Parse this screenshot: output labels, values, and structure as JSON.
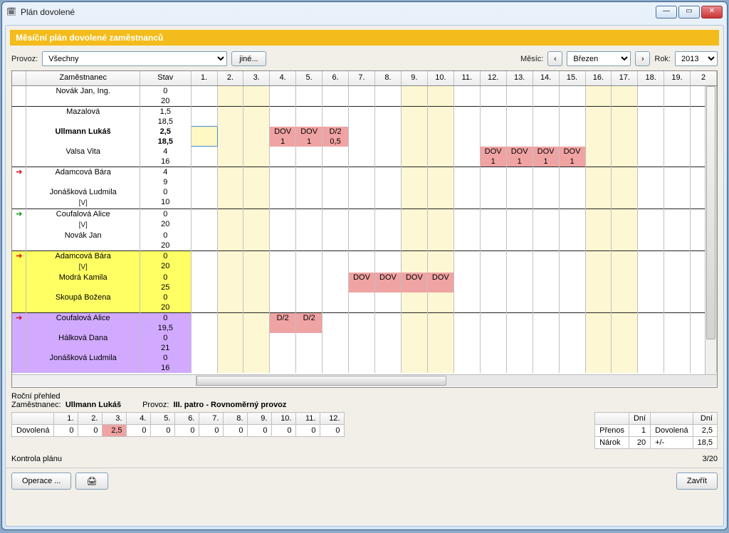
{
  "window": {
    "title": "Plán dovolené"
  },
  "banner": "Měsíční plán dovolené zaměstnanců",
  "filter": {
    "provoz_label": "Provoz:",
    "provoz_value": "Všechny",
    "jine_label": "jiné...",
    "mesic_label": "Měsíc:",
    "mesic_value": "Březen",
    "rok_label": "Rok:",
    "rok_value": "2013",
    "prev": "‹",
    "next": "›"
  },
  "grid": {
    "headers": {
      "icon": "",
      "employee": "Zaměstnanec",
      "stav": "Stav",
      "days": [
        "1.",
        "2.",
        "3.",
        "4.",
        "5.",
        "6.",
        "7.",
        "8.",
        "9.",
        "10.",
        "11.",
        "12.",
        "13.",
        "14.",
        "15.",
        "16.",
        "17.",
        "18.",
        "19.",
        "2"
      ]
    },
    "weekend_cols": [
      1,
      2,
      8,
      9,
      15,
      16
    ],
    "rows": [
      {
        "group": true,
        "name": "Novák Jan, Ing.",
        "stav": [
          "0",
          "20"
        ],
        "cells": {}
      },
      {
        "group": true,
        "name": "Mazalová",
        "stav": [
          "1,5",
          "18,5"
        ],
        "cells": {}
      },
      {
        "bold": true,
        "selected": true,
        "name": "Ullmann Lukáš",
        "stav": [
          "2,5",
          "18,5"
        ],
        "cells": {
          "3": {
            "t1": "DOV",
            "t2": "1",
            "pink": true
          },
          "4": {
            "t1": "DOV",
            "t2": "1",
            "pink": true
          },
          "5": {
            "t1": "D/2",
            "t2": "0,5",
            "pink": true
          }
        }
      },
      {
        "name": "Valsa Vita",
        "stav": [
          "4",
          "16"
        ],
        "cells": {
          "11": {
            "t1": "DOV",
            "t2": "1",
            "pink": true
          },
          "12": {
            "t1": "DOV",
            "t2": "1",
            "pink": true
          },
          "13": {
            "t1": "DOV",
            "t2": "1",
            "pink": true
          },
          "14": {
            "t1": "DOV",
            "t2": "1",
            "pink": true
          }
        }
      },
      {
        "group": true,
        "icon": "ared",
        "name": "Adamcová Bára",
        "stav": [
          "4",
          "9"
        ],
        "cells": {}
      },
      {
        "name": "Jonášková Ludmila",
        "sub": "[V]",
        "stav": [
          "0",
          "10"
        ],
        "cells": {}
      },
      {
        "group": true,
        "icon": "agreen",
        "name": "Coufalová Alice",
        "sub": "[V]",
        "stav": [
          "0",
          "20"
        ],
        "cells": {}
      },
      {
        "name": "Novák Jan",
        "stav": [
          "0",
          "20"
        ],
        "cells": {}
      },
      {
        "group": true,
        "icon": "ared",
        "name": "Adamcová Bára",
        "sub": "[V]",
        "yellow": true,
        "stav": [
          "0",
          "20"
        ],
        "cells": {}
      },
      {
        "name": "Modrá Kamila",
        "yellow": true,
        "stav": [
          "0",
          "25"
        ],
        "cells": {
          "6": {
            "t1": "DOV",
            "pink": true
          },
          "7": {
            "t1": "DOV",
            "pink": true
          },
          "8": {
            "t1": "DOV",
            "pink": true
          },
          "9": {
            "t1": "DOV",
            "pink": true
          }
        }
      },
      {
        "name": "Skoupá Božena",
        "yellow": true,
        "stav": [
          "0",
          "20"
        ],
        "cells": {}
      },
      {
        "group": true,
        "icon": "ared",
        "name": "Coufalová Alice",
        "purple": true,
        "stav": [
          "0",
          "19,5"
        ],
        "cells": {
          "3": {
            "t1": "D/2",
            "pink": true
          },
          "4": {
            "t1": "D/2",
            "pink": true
          }
        }
      },
      {
        "name": "Hálková Dana",
        "purple": true,
        "stav": [
          "0",
          "21"
        ],
        "cells": {}
      },
      {
        "name": "Jonášková Ludmila",
        "purple": true,
        "stav": [
          "0",
          "16"
        ],
        "cells": {}
      }
    ]
  },
  "summary": {
    "rocni_label": "Roční přehled",
    "zamest_label": "Zaměstnanec:",
    "zamest_value": "Ullmann Lukáš",
    "provoz_label": "Provoz:",
    "provoz_value": "III. patro - Rovnoměrný provoz",
    "months": [
      "1.",
      "2.",
      "3.",
      "4.",
      "5.",
      "6.",
      "7.",
      "8.",
      "9.",
      "10.",
      "11.",
      "12."
    ],
    "dovolena_label": "Dovolená",
    "dovolena_vals": [
      "0",
      "0",
      "2,5",
      "0",
      "0",
      "0",
      "0",
      "0",
      "0",
      "0",
      "0",
      "0"
    ],
    "right_h1": "Dní",
    "right_h2": "Dní",
    "prenos_l": "Přenos",
    "prenos_v": "1",
    "narok_l": "Nárok",
    "narok_v": "20",
    "dov_l": "Dovolená",
    "dov_v": "2,5",
    "pm_l": "+/-",
    "pm_v": "18,5",
    "kontrola": "Kontrola plánu",
    "counter": "3/20"
  },
  "buttons": {
    "operace": "Operace ...",
    "zavrit": "Zavřít"
  }
}
